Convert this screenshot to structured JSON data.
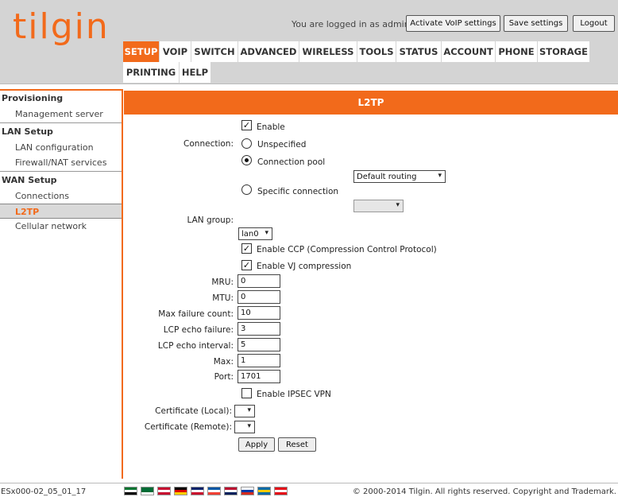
{
  "brand": {
    "logo_text": "tilgin",
    "accent": "#f26a1b"
  },
  "header": {
    "login_text": "You are logged in as admin.",
    "buttons": {
      "activate_voip": "Activate VoIP settings",
      "save": "Save settings",
      "logout": "Logout"
    }
  },
  "tabs": [
    {
      "label": "SETUP",
      "active": true
    },
    {
      "label": "VOIP"
    },
    {
      "label": "SWITCH"
    },
    {
      "label": "ADVANCED"
    },
    {
      "label": "WIRELESS"
    },
    {
      "label": "TOOLS"
    },
    {
      "label": "STATUS"
    },
    {
      "label": "ACCOUNT"
    },
    {
      "label": "PHONE"
    },
    {
      "label": "STORAGE"
    },
    {
      "label": "PRINTING"
    },
    {
      "label": "HELP"
    }
  ],
  "sidebar": {
    "groups": [
      {
        "title": "Provisioning",
        "items": [
          "Management server"
        ]
      },
      {
        "title": "LAN Setup",
        "items": [
          "LAN configuration",
          "Firewall/NAT services"
        ]
      },
      {
        "title": "WAN Setup",
        "items": [
          "Connections",
          "L2TP",
          "Cellular network"
        ]
      }
    ],
    "active_item": "L2TP"
  },
  "page": {
    "title": "L2TP",
    "enable_label": "Enable",
    "enable_checked": true,
    "connection_label": "Connection:",
    "radio_unspecified": "Unspecified",
    "radio_pool": "Connection pool",
    "radio_specific": "Specific connection",
    "connection_selected": "Connection pool",
    "pool_select_value": "Default routing",
    "specific_select_value": "",
    "lan_group_label": "LAN group:",
    "lan_group_value": "lan0",
    "ccp_label": "Enable CCP (Compression Control Protocol)",
    "ccp_checked": true,
    "vj_label": "Enable VJ compression",
    "vj_checked": true,
    "fields": {
      "mru": {
        "label": "MRU:",
        "value": "0"
      },
      "mtu": {
        "label": "MTU:",
        "value": "0"
      },
      "max_failure": {
        "label": "Max failure count:",
        "value": "10"
      },
      "lcp_failure": {
        "label": "LCP echo failure:",
        "value": "3"
      },
      "lcp_interval": {
        "label": "LCP echo interval:",
        "value": "5"
      },
      "max": {
        "label": "Max:",
        "value": "1"
      },
      "port": {
        "label": "Port:",
        "value": "1701"
      }
    },
    "ipsec_label": "Enable IPSEC VPN",
    "ipsec_checked": false,
    "cert_local_label": "Certificate (Local):",
    "cert_remote_label": "Certificate (Remote):",
    "apply_label": "Apply",
    "reset_label": "Reset"
  },
  "footer": {
    "version": "ESx000-02_05_01_17",
    "copyright": "© 2000-2014 Tilgin. All rights reserved. Copyright and Trademark.",
    "flags": [
      {
        "name": "uae-flag",
        "colors": [
          "#00732f",
          "#ffffff",
          "#000000",
          "#ff0000"
        ]
      },
      {
        "name": "saudi-flag",
        "colors": [
          "#006c35",
          "#006c35",
          "#ffffff",
          "#006c35"
        ]
      },
      {
        "name": "denmark-flag",
        "colors": [
          "#c60c30",
          "#ffffff",
          "#c60c30",
          "#c60c30"
        ]
      },
      {
        "name": "germany-flag",
        "colors": [
          "#000000",
          "#dd0000",
          "#ffce00",
          "#ffce00"
        ]
      },
      {
        "name": "uk-flag",
        "colors": [
          "#012169",
          "#ffffff",
          "#c8102e",
          "#012169"
        ]
      },
      {
        "name": "france-flag",
        "colors": [
          "#0055a4",
          "#ffffff",
          "#ef4135",
          "#ef4135"
        ]
      },
      {
        "name": "norway-flag",
        "colors": [
          "#ba0c2f",
          "#ffffff",
          "#00205b",
          "#ba0c2f"
        ]
      },
      {
        "name": "russia-flag",
        "colors": [
          "#ffffff",
          "#0039a6",
          "#d52b1e",
          "#d52b1e"
        ]
      },
      {
        "name": "sweden-flag",
        "colors": [
          "#006aa7",
          "#fecc00",
          "#006aa7",
          "#006aa7"
        ]
      },
      {
        "name": "turkey-flag",
        "colors": [
          "#e30a17",
          "#ffffff",
          "#e30a17",
          "#e30a17"
        ]
      }
    ]
  }
}
